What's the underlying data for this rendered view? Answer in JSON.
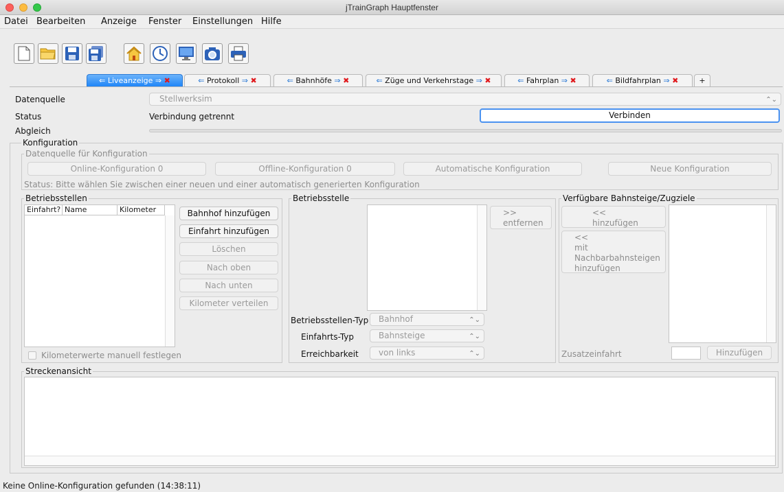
{
  "window": {
    "title": "jTrainGraph Hauptfenster"
  },
  "menu": [
    "Datei",
    "Bearbeiten",
    "Anzeige",
    "Fenster",
    "Einstellungen",
    "Hilfe"
  ],
  "toolbar": {
    "icons": [
      "new-file-icon",
      "open-folder-icon",
      "save-icon",
      "save-as-icon",
      "home-icon",
      "clock-icon",
      "monitor-icon",
      "camera-icon",
      "printer-icon"
    ]
  },
  "tabs": [
    {
      "label": "Liveanzeige",
      "active": true
    },
    {
      "label": "Protokoll"
    },
    {
      "label": "Bahnhöfe"
    },
    {
      "label": "Züge und Verkehrstage"
    },
    {
      "label": "Fahrplan"
    },
    {
      "label": "Bildfahrplan"
    }
  ],
  "tab_add": "+",
  "tab_arrow_left": "⇐",
  "tab_arrow_right": "⇒",
  "tab_close": "✖",
  "form": {
    "datenquelle_label": "Datenquelle",
    "datenquelle_value": "Stellwerksim",
    "status_label": "Status",
    "status_value": "Verbindung getrennt",
    "verbinden_button": "Verbinden",
    "abgleich_label": "Abgleich",
    "abgleich_progress": 0
  },
  "konfiguration": {
    "legend": "Konfiguration",
    "datenquelle_legend": "Datenquelle für Konfiguration",
    "buttons": [
      "Online-Konfiguration 0",
      "Offline-Konfiguration 0",
      "Automatische Konfiguration",
      "Neue Konfiguration"
    ],
    "status_text": "Status: Bitte wählen Sie zwischen einer neuen und einer automatisch generierten Konfiguration"
  },
  "betriebsstellen": {
    "legend": "Betriebsstellen",
    "columns": [
      "Einfahrt?",
      "Name",
      "Kilometer"
    ],
    "buttons": {
      "bahnhof": "Bahnhof hinzufügen",
      "einfahrt": "Einfahrt hinzufügen",
      "loeschen": "Löschen",
      "nach_oben": "Nach oben",
      "nach_unten": "Nach unten",
      "km_verteilen": "Kilometer verteilen"
    },
    "checkbox_label": "Kilometerwerte manuell festlegen"
  },
  "betriebsstelle": {
    "legend": "Betriebsstelle",
    "entfernen_line1": ">>",
    "entfernen_line2": "entfernen",
    "typ_label": "Betriebsstellen-Typ",
    "typ_value": "Bahnhof",
    "einfahrts_typ_label": "Einfahrts-Typ",
    "einfahrts_typ_value": "Bahnsteige",
    "erreichbarkeit_label": "Erreichbarkeit",
    "erreichbarkeit_value": "von links"
  },
  "bahnsteige": {
    "legend": "Verfügbare Bahnsteige/Zugziele",
    "hinzufuegen_line1": "<<",
    "hinzufuegen_line2": "hinzufügen",
    "nachbar_lines": [
      "<<",
      "mit",
      "Nachbarbahnsteigen",
      "hinzufügen"
    ],
    "zusatz_label": "Zusatzeinfahrt",
    "zusatz_button": "Hinzufügen"
  },
  "streckenansicht": {
    "legend": "Streckenansicht"
  },
  "statusbar": {
    "text": "Keine Online-Konfiguration gefunden (14:38:11)"
  }
}
